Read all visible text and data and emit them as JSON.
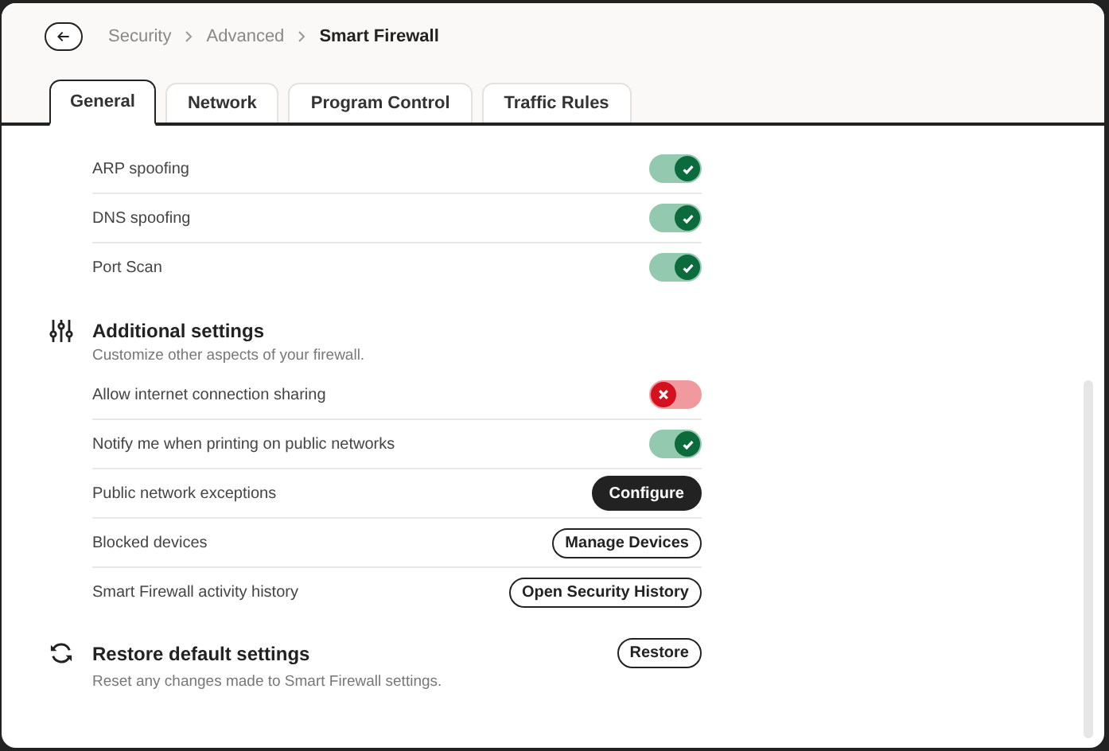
{
  "breadcrumb": [
    {
      "label": "Security",
      "current": false
    },
    {
      "label": "Advanced",
      "current": false
    },
    {
      "label": "Smart Firewall",
      "current": true
    }
  ],
  "tabs": [
    {
      "label": "General",
      "selected": true
    },
    {
      "label": "Network",
      "selected": false
    },
    {
      "label": "Program Control",
      "selected": false
    },
    {
      "label": "Traffic Rules",
      "selected": false
    }
  ],
  "attack_rows": [
    {
      "label": "ARP spoofing",
      "on": true
    },
    {
      "label": "DNS spoofing",
      "on": true
    },
    {
      "label": "Port Scan",
      "on": true
    }
  ],
  "additional_settings": {
    "title": "Additional settings",
    "subtitle": "Customize other aspects of your firewall.",
    "rows": [
      {
        "kind": "toggle",
        "label": "Allow internet connection sharing",
        "on": false
      },
      {
        "kind": "toggle",
        "label": "Notify me when printing on public networks",
        "on": true
      },
      {
        "kind": "button",
        "label": "Public network exceptions",
        "button": "Configure",
        "primary": true
      },
      {
        "kind": "button",
        "label": "Blocked devices",
        "button": "Manage Devices",
        "primary": false
      },
      {
        "kind": "button",
        "label": "Smart Firewall activity history",
        "button": "Open Security History",
        "primary": false
      }
    ]
  },
  "restore": {
    "title": "Restore default settings",
    "subtitle": "Reset any changes made to Smart Firewall settings.",
    "button": "Restore"
  }
}
